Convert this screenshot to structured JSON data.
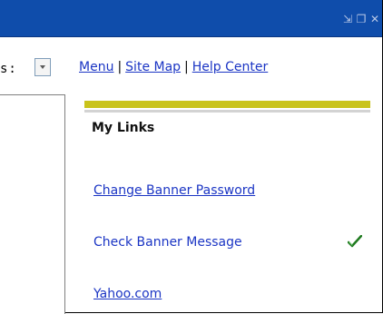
{
  "window": {
    "controls": {
      "minimize_icon": "minimize-icon",
      "restore_icon": "restore-icon",
      "close_icon": "close-icon",
      "minimize_glyph": "⇲",
      "restore_glyph": "❐",
      "close_glyph": "✕"
    },
    "titlebar_color": "#0f4dab"
  },
  "toolbar": {
    "cut_label": "s:"
  },
  "topnav": {
    "links": [
      "Menu",
      "Site Map",
      "Help Center"
    ],
    "separator": "|"
  },
  "my_links": {
    "title": "My Links",
    "items": [
      {
        "label": "Change Banner Password"
      },
      {
        "label": "Check Banner Message"
      },
      {
        "label": "Yahoo.com"
      }
    ]
  },
  "colors": {
    "link": "#1b35c4",
    "accent_bar": "#c9c31b",
    "check": "#1f7a1f"
  }
}
